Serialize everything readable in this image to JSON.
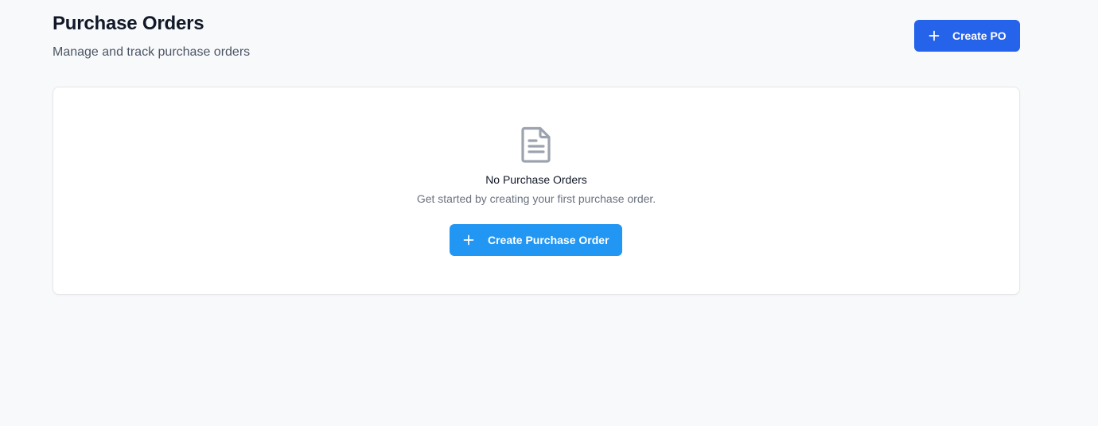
{
  "header": {
    "title": "Purchase Orders",
    "subtitle": "Manage and track purchase orders",
    "create_button_label": "Create PO"
  },
  "empty_state": {
    "icon": "document-icon",
    "title": "No Purchase Orders",
    "description": "Get started by creating your first purchase order.",
    "button_label": "Create Purchase Order"
  },
  "colors": {
    "primary": "#2563eb",
    "secondary_primary": "#2196f3",
    "background": "#f8f9fb",
    "icon": "#9ca3af"
  }
}
